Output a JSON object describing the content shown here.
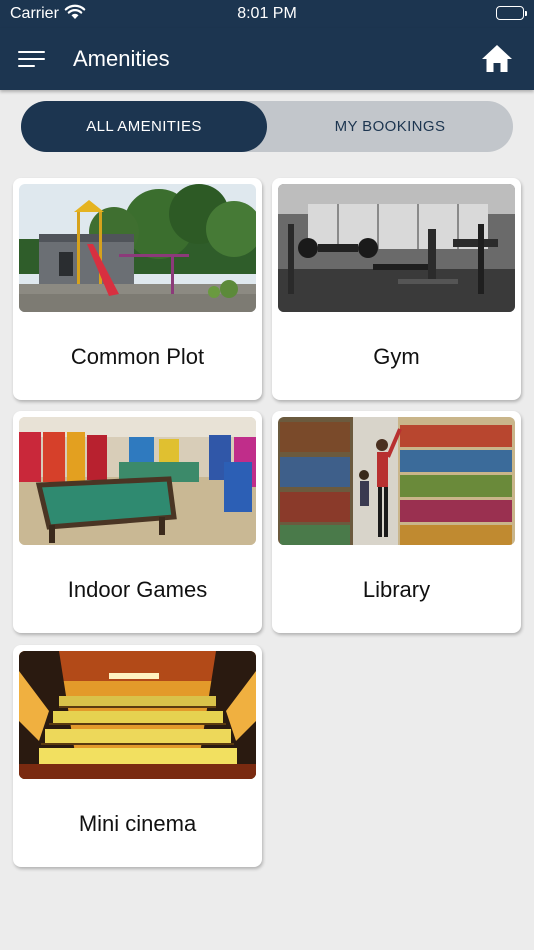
{
  "status_bar": {
    "carrier": "Carrier",
    "time": "8:01 PM"
  },
  "nav": {
    "title": "Amenities"
  },
  "tabs": [
    {
      "label": "ALL AMENITIES",
      "active": true
    },
    {
      "label": "MY BOOKINGS",
      "active": false
    }
  ],
  "amenities": [
    {
      "name": "Common Plot",
      "image": "playground-photo"
    },
    {
      "name": "Gym",
      "image": "gym-photo"
    },
    {
      "name": "Indoor Games",
      "image": "arcade-photo"
    },
    {
      "name": "Library",
      "image": "library-photo"
    },
    {
      "name": "Mini cinema",
      "image": "cinema-photo"
    }
  ],
  "colors": {
    "primary": "#1c3550",
    "segment_bg": "#c2c6cb",
    "page_bg": "#ececec"
  }
}
